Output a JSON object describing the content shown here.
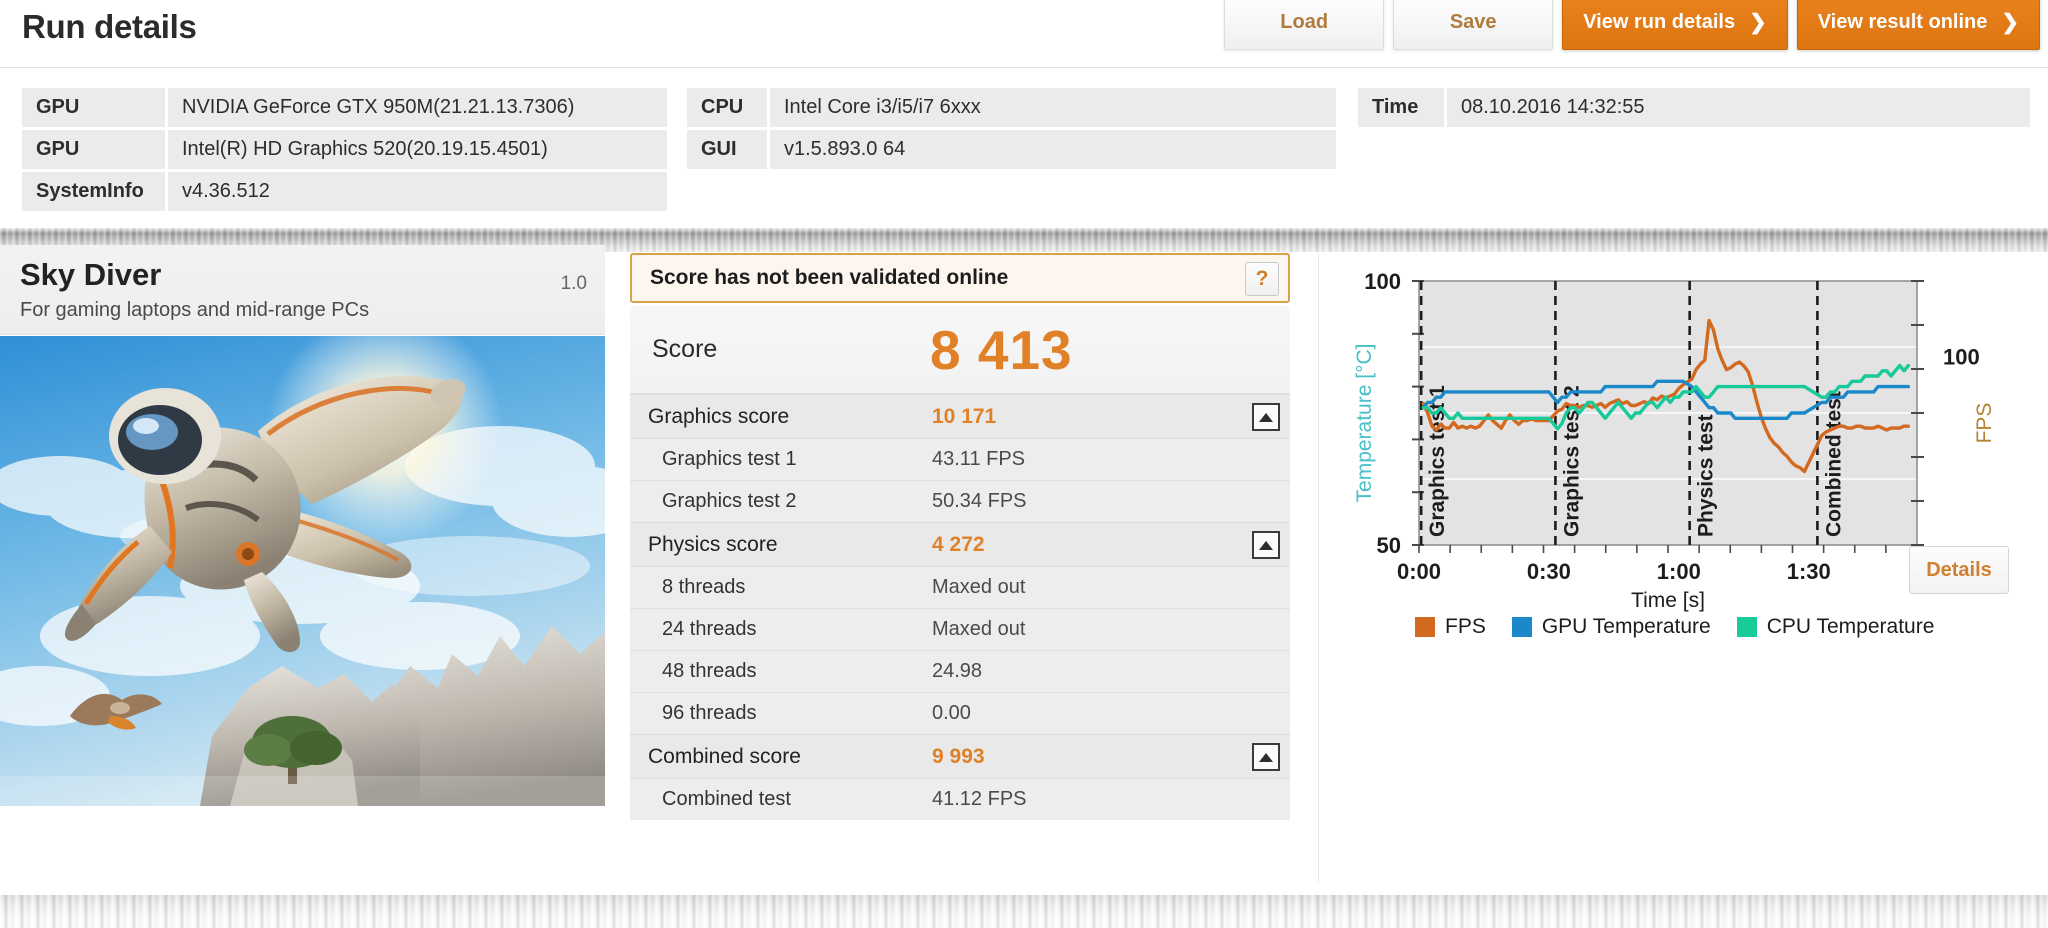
{
  "header": {
    "title": "Run details",
    "buttons": [
      {
        "label": "Load",
        "style": "light"
      },
      {
        "label": "Save",
        "style": "light"
      },
      {
        "label": "View run details",
        "style": "orange",
        "chevron": "❯"
      },
      {
        "label": "View result online",
        "style": "orange",
        "chevron": "❯"
      }
    ]
  },
  "sysinfo": {
    "col1": [
      {
        "key": "GPU",
        "value": "NVIDIA GeForce GTX 950M(21.21.13.7306)"
      },
      {
        "key": "GPU",
        "value": "Intel(R) HD Graphics 520(20.19.15.4501)"
      },
      {
        "key": "SystemInfo",
        "value": "v4.36.512"
      }
    ],
    "col2": [
      {
        "key": "CPU",
        "value": "Intel Core i3/i5/i7 6xxx"
      },
      {
        "key": "GUI",
        "value": "v1.5.893.0 64"
      }
    ],
    "col3": [
      {
        "key": "Time",
        "value": "08.10.2016 14:32:55"
      }
    ]
  },
  "test": {
    "name": "Sky Diver",
    "subtitle": "For gaming laptops and mid-range PCs",
    "version": "1.0",
    "hero_alt": "wingsuit-flyer-over-canyon"
  },
  "score_panel": {
    "validation_message": "Score has not been validated online",
    "help_label": "?",
    "total_label": "Score",
    "total_value": "8 413",
    "groups": [
      {
        "label": "Graphics score",
        "value": "10 171",
        "collapse_icon": "triangle-up",
        "rows": [
          {
            "label": "Graphics test 1",
            "value": "43.11 FPS"
          },
          {
            "label": "Graphics test 2",
            "value": "50.34 FPS"
          }
        ]
      },
      {
        "label": "Physics score",
        "value": "4 272",
        "collapse_icon": "triangle-up",
        "rows": [
          {
            "label": "8 threads",
            "value": "Maxed out"
          },
          {
            "label": "24 threads",
            "value": "Maxed out"
          },
          {
            "label": "48 threads",
            "value": "24.98"
          },
          {
            "label": "96 threads",
            "value": "0.00"
          }
        ]
      },
      {
        "label": "Combined score",
        "value": "9 993",
        "collapse_icon": "triangle-up",
        "rows": [
          {
            "label": "Combined test",
            "value": "41.12 FPS"
          }
        ]
      }
    ]
  },
  "chart_panel": {
    "details_label": "Details"
  },
  "colors": {
    "accent_orange": "#e08128",
    "fps_line": "#d2691e",
    "gpu_temp_line": "#1b89c9",
    "cpu_temp_line": "#18c99a",
    "validate_border": "#d9a04a"
  },
  "chart_data": {
    "type": "line",
    "title": "",
    "xlabel": "Time [s]",
    "ylabel_left": "Temperature [°C]",
    "ylabel_right": "FPS",
    "x_tick_labels": [
      "0:00",
      "0:30",
      "1:00",
      "1:30"
    ],
    "x_tick_values": [
      0,
      30,
      60,
      90
    ],
    "xlim": [
      0,
      115
    ],
    "left_axis": {
      "ticks": [
        50,
        100
      ],
      "tick_labels": [
        "50",
        "100"
      ],
      "ylim": [
        50,
        100
      ]
    },
    "right_axis": {
      "ticks": [
        100
      ],
      "tick_labels": [
        "100"
      ],
      "ylim": [
        0,
        140
      ]
    },
    "grid": true,
    "legend_position": "bottom",
    "legend": [
      {
        "name": "FPS",
        "color": "#d2691e"
      },
      {
        "name": "GPU Temperature",
        "color": "#1b89c9"
      },
      {
        "name": "CPU Temperature",
        "color": "#18c99a"
      }
    ],
    "phase_markers": [
      {
        "label": "Graphics test 1",
        "x": 0.5
      },
      {
        "label": "Graphics test 2",
        "x": 31.5
      },
      {
        "label": "Physics test",
        "x": 62.5
      },
      {
        "label": "Combined test",
        "x": 92.0
      }
    ],
    "series": [
      {
        "name": "FPS",
        "color": "#d2691e",
        "axis": "right",
        "x": [
          1,
          2,
          3,
          4,
          5,
          6,
          7,
          8,
          9,
          10,
          11,
          12,
          13,
          14,
          15,
          16,
          17,
          18,
          19,
          20,
          21,
          22,
          23,
          24,
          25,
          26,
          27,
          28,
          29,
          30,
          32,
          33,
          34,
          35,
          36,
          37,
          38,
          39,
          40,
          41,
          42,
          43,
          44,
          45,
          46,
          47,
          48,
          49,
          50,
          51,
          52,
          53,
          54,
          55,
          56,
          57,
          58,
          59,
          60,
          61,
          63,
          64,
          65,
          66,
          67,
          68,
          69,
          70,
          71,
          72,
          73,
          74,
          75,
          76,
          77,
          78,
          79,
          80,
          81,
          82,
          83,
          84,
          85,
          86,
          87,
          88,
          89,
          93,
          94,
          95,
          96,
          97,
          98,
          99,
          100,
          101,
          102,
          103,
          104,
          105,
          106,
          107,
          108,
          109,
          110,
          111,
          112,
          113
        ],
        "y": [
          75,
          70,
          63,
          61,
          64,
          62,
          62,
          65,
          62,
          63,
          62,
          63,
          62,
          63,
          66,
          69,
          66,
          64,
          62,
          66,
          69,
          66,
          64,
          66,
          66,
          67,
          66,
          66,
          66,
          66,
          71,
          72,
          75,
          74,
          74,
          73,
          74,
          74,
          73,
          74,
          75,
          73,
          75,
          76,
          77,
          75,
          76,
          74,
          74,
          75,
          76,
          75,
          78,
          77,
          79,
          78,
          79,
          80,
          83,
          85,
          88,
          93,
          96,
          98,
          119,
          114,
          104,
          98,
          93,
          94,
          96,
          97,
          95,
          92,
          85,
          76,
          68,
          62,
          57,
          54,
          52,
          49,
          47,
          44,
          42,
          41,
          39,
          58,
          60,
          61,
          62,
          63,
          63,
          62,
          62,
          63,
          63,
          62,
          62,
          62,
          63,
          62,
          61,
          62,
          62,
          62,
          63,
          63
        ]
      },
      {
        "name": "GPU Temperature",
        "color": "#1b89c9",
        "axis": "left",
        "x": [
          1,
          2,
          3,
          4,
          5,
          6,
          7,
          8,
          9,
          10,
          11,
          12,
          13,
          14,
          15,
          16,
          17,
          18,
          19,
          20,
          21,
          22,
          23,
          24,
          25,
          26,
          27,
          28,
          29,
          30,
          32,
          33,
          34,
          35,
          36,
          37,
          38,
          39,
          40,
          41,
          42,
          43,
          44,
          45,
          46,
          47,
          48,
          49,
          50,
          51,
          52,
          53,
          54,
          55,
          56,
          57,
          58,
          59,
          60,
          61,
          63,
          64,
          65,
          66,
          67,
          68,
          69,
          70,
          71,
          72,
          73,
          74,
          75,
          76,
          77,
          78,
          79,
          80,
          81,
          82,
          83,
          84,
          85,
          86,
          87,
          88,
          89,
          93,
          94,
          95,
          96,
          97,
          98,
          99,
          100,
          101,
          102,
          103,
          104,
          105,
          106,
          107,
          108,
          109,
          110,
          111,
          112,
          113
        ],
        "y": [
          76,
          77,
          77,
          78,
          78,
          79,
          79,
          79,
          79,
          79,
          79,
          79,
          79,
          79,
          79,
          79,
          79,
          79,
          79,
          79,
          79,
          79,
          79,
          79,
          79,
          79,
          79,
          79,
          79,
          79,
          77,
          78,
          78,
          79,
          79,
          79,
          79,
          79,
          79,
          79,
          79,
          80,
          80,
          80,
          80,
          80,
          80,
          80,
          80,
          80,
          80,
          80,
          80,
          81,
          81,
          81,
          81,
          81,
          81,
          81,
          80,
          79,
          78,
          77,
          76,
          76,
          75,
          75,
          75,
          75,
          74,
          74,
          74,
          74,
          74,
          74,
          74,
          74,
          74,
          74,
          74,
          74,
          74,
          75,
          75,
          75,
          75,
          77,
          77,
          78,
          78,
          78,
          78,
          79,
          79,
          79,
          79,
          79,
          79,
          79,
          80,
          80,
          80,
          80,
          80,
          80,
          80,
          80
        ]
      },
      {
        "name": "CPU Temperature",
        "color": "#18c99a",
        "axis": "left",
        "x": [
          1,
          2,
          3,
          4,
          5,
          6,
          7,
          8,
          9,
          10,
          11,
          12,
          13,
          14,
          15,
          16,
          17,
          18,
          19,
          20,
          21,
          22,
          23,
          24,
          25,
          26,
          27,
          28,
          29,
          30,
          32,
          33,
          34,
          35,
          36,
          37,
          38,
          39,
          40,
          41,
          42,
          43,
          44,
          45,
          46,
          47,
          48,
          49,
          50,
          51,
          52,
          53,
          54,
          55,
          56,
          57,
          58,
          59,
          60,
          61,
          63,
          64,
          65,
          66,
          67,
          68,
          69,
          70,
          71,
          72,
          73,
          74,
          75,
          76,
          77,
          78,
          79,
          80,
          81,
          82,
          83,
          84,
          85,
          86,
          87,
          88,
          89,
          93,
          94,
          95,
          96,
          97,
          98,
          99,
          100,
          101,
          102,
          103,
          104,
          105,
          106,
          107,
          108,
          109,
          110,
          111,
          112,
          113
        ],
        "y": [
          76,
          76,
          75,
          75,
          76,
          75,
          74,
          74,
          75,
          74,
          74,
          74,
          74,
          74,
          74,
          74,
          74,
          74,
          74,
          74,
          74,
          74,
          74,
          74,
          74,
          74,
          74,
          74,
          74,
          74,
          72,
          73,
          75,
          76,
          76,
          75,
          76,
          77,
          77,
          76,
          75,
          74,
          75,
          76,
          77,
          76,
          75,
          74,
          75,
          75,
          76,
          77,
          77,
          76,
          77,
          78,
          77,
          78,
          78,
          79,
          79,
          80,
          79,
          78,
          78,
          79,
          80,
          80,
          80,
          80,
          80,
          80,
          80,
          80,
          80,
          80,
          80,
          80,
          80,
          80,
          80,
          80,
          80,
          80,
          80,
          80,
          80,
          78,
          78,
          79,
          79,
          80,
          80,
          80,
          81,
          81,
          81,
          82,
          82,
          82,
          82,
          83,
          83,
          82,
          83,
          84,
          83,
          84
        ]
      }
    ]
  }
}
